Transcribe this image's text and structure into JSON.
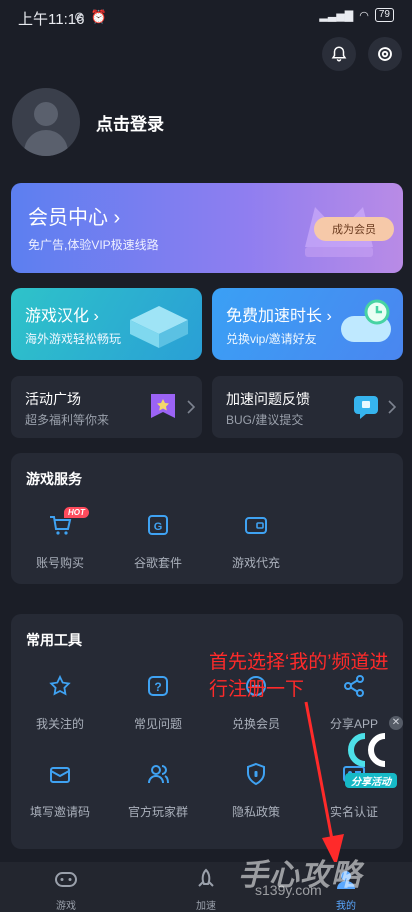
{
  "status_bar": {
    "time": "上午11:16",
    "battery": "79"
  },
  "profile": {
    "login_label": "点击登录"
  },
  "vip": {
    "title": "会员中心",
    "subtitle": "免广告,体验VIP极速线路",
    "button_label": "成为会员"
  },
  "promo_cards": [
    {
      "title": "游戏汉化",
      "subtitle": "海外游戏轻松畅玩"
    },
    {
      "title": "免费加速时长",
      "subtitle": "兑换vip/邀请好友"
    }
  ],
  "mini_cards": [
    {
      "title": "活动广场",
      "subtitle": "超多福利等你来"
    },
    {
      "title": "加速问题反馈",
      "subtitle": "BUG/建议提交"
    }
  ],
  "game_services": {
    "heading": "游戏服务",
    "items": [
      {
        "label": "账号购买",
        "icon": "cart-icon",
        "badge": "HOT"
      },
      {
        "label": "谷歌套件",
        "icon": "google-suite-icon"
      },
      {
        "label": "游戏代充",
        "icon": "wallet-icon"
      }
    ]
  },
  "tools": {
    "heading": "常用工具",
    "items": [
      {
        "label": "我关注的",
        "icon": "star-icon"
      },
      {
        "label": "常见问题",
        "icon": "question-icon"
      },
      {
        "label": "兑换会员",
        "icon": "exchange-icon"
      },
      {
        "label": "分享APP",
        "icon": "share-icon"
      },
      {
        "label": "填写邀请码",
        "icon": "invite-icon"
      },
      {
        "label": "官方玩家群",
        "icon": "group-icon"
      },
      {
        "label": "隐私政策",
        "icon": "shield-icon"
      },
      {
        "label": "实名认证",
        "icon": "id-card-icon"
      }
    ]
  },
  "annotation": {
    "text": "首先选择‘我的’频道进行注册一下"
  },
  "floating_badge": {
    "label": "分享活动"
  },
  "tabbar": {
    "tabs": [
      {
        "label": "游戏",
        "icon": "gamepad-icon"
      },
      {
        "label": "加速",
        "icon": "rocket-icon"
      },
      {
        "label": "我的",
        "icon": "user-icon",
        "active": true
      }
    ]
  },
  "watermark": {
    "text": "手心攻略",
    "sub": "s139y.com"
  },
  "colors": {
    "accent": "#5aa8ff",
    "annotation": "#ff2a2a",
    "background": "#1b1e27"
  }
}
